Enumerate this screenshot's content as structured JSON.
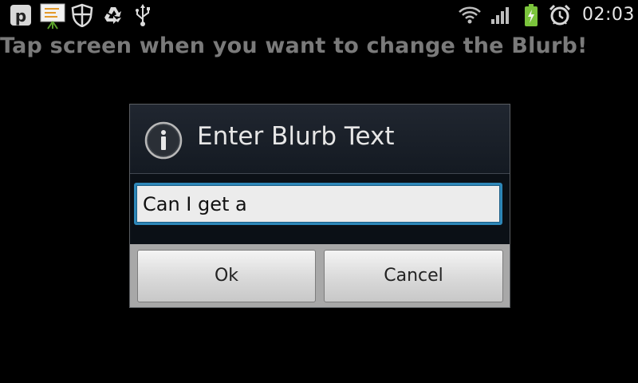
{
  "status_bar": {
    "time": "02:03",
    "left_icons": [
      "p-notification-icon",
      "presentation-icon",
      "shield-icon",
      "recycle-icon",
      "usb-icon"
    ],
    "right_icons": [
      "wifi-icon",
      "signal-icon",
      "battery-charging-icon",
      "alarm-icon"
    ],
    "battery_color": "#7bc43c"
  },
  "app": {
    "instruction": "Tap screen when you want to change the Blurb!"
  },
  "dialog": {
    "icon": "info-icon",
    "title": "Enter Blurb Text",
    "input_value": "Can I get a",
    "ok_label": "Ok",
    "cancel_label": "Cancel",
    "accent_color": "#2e87b8"
  }
}
